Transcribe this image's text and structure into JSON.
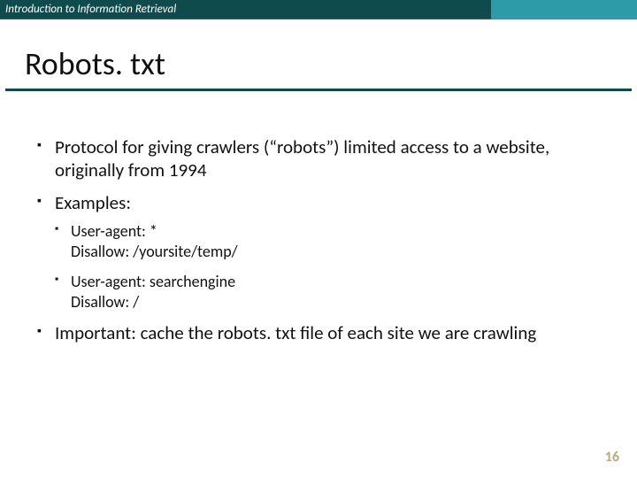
{
  "header": {
    "course": "Introduction to Information Retrieval"
  },
  "title": "Robots. txt",
  "bullets": {
    "b1": "Protocol for giving crawlers (“robots”) limited access to a website, originally from 1994",
    "b2": "Examples:",
    "b2s1a": "User-agent: *",
    "b2s1b": "Disallow: /yoursite/temp/",
    "b2s2a": "User-agent: searchengine",
    "b2s2b": "Disallow: /",
    "b3": "Important: cache the robots. txt file of each site we are crawling"
  },
  "page_number": "16"
}
